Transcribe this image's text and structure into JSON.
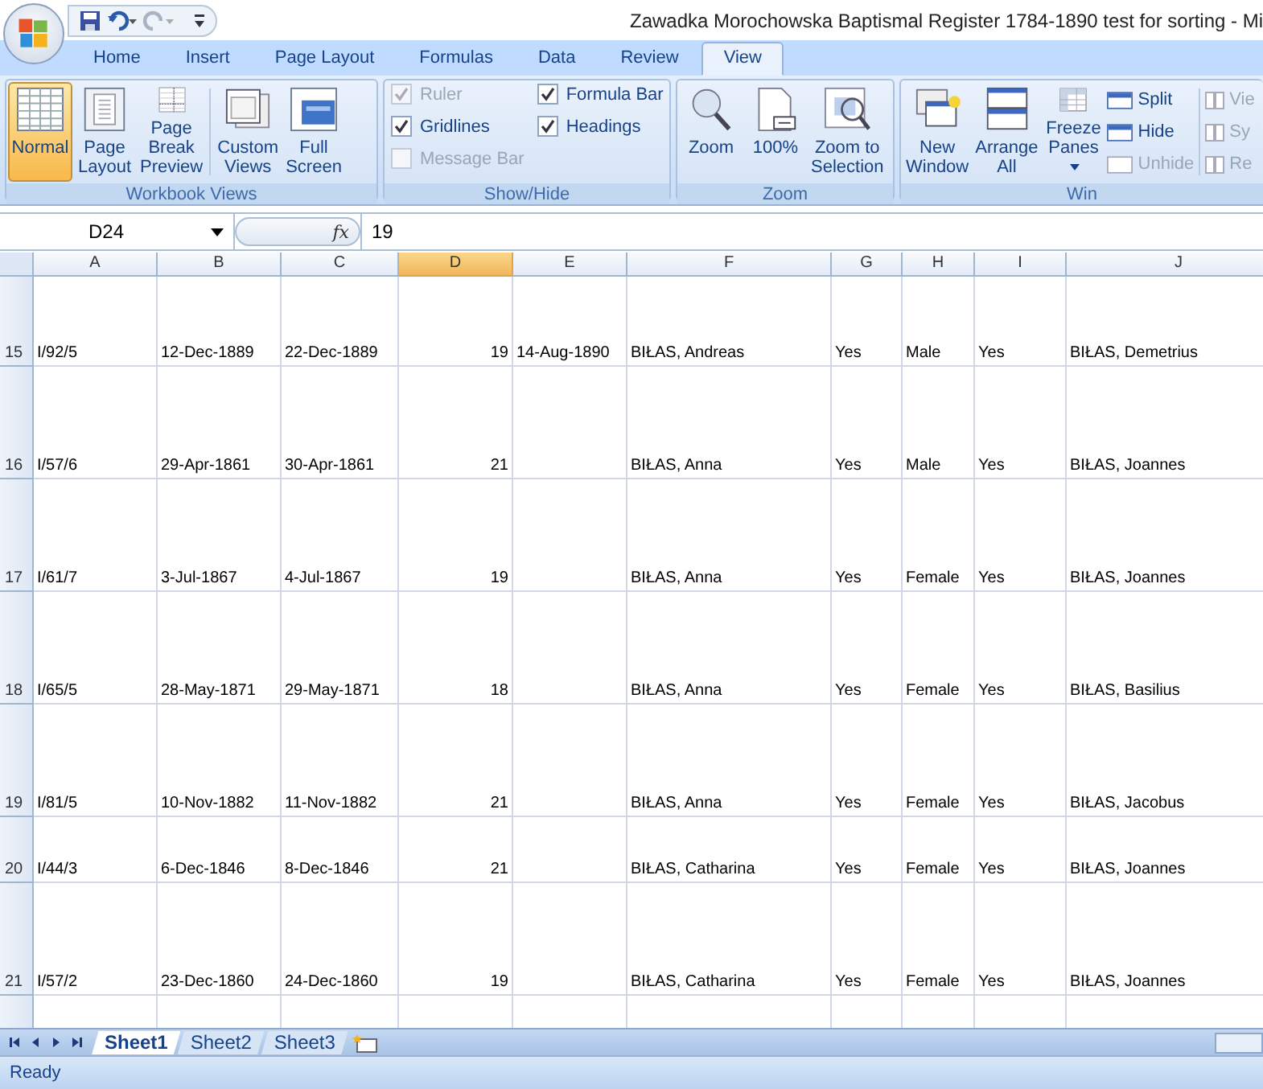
{
  "title": "Zawadka Morochowska Baptismal Register 1784-1890 test for sorting - Mi",
  "tabs": [
    {
      "label": "Home",
      "selected": false
    },
    {
      "label": "Insert",
      "selected": false
    },
    {
      "label": "Page Layout",
      "selected": false
    },
    {
      "label": "Formulas",
      "selected": false
    },
    {
      "label": "Data",
      "selected": false
    },
    {
      "label": "Review",
      "selected": false
    },
    {
      "label": "View",
      "selected": true
    }
  ],
  "workbook_views": {
    "title": "Workbook Views",
    "buttons": [
      {
        "label": "Normal",
        "selected": true
      },
      {
        "label": "Page Layout",
        "selected": false
      },
      {
        "label": "Page Break Preview",
        "selected": false
      },
      {
        "label": "Custom Views",
        "selected": false
      },
      {
        "label": "Full Screen",
        "selected": false
      }
    ]
  },
  "show_hide": {
    "title": "Show/Hide",
    "checkboxes": [
      {
        "label": "Ruler",
        "checked": true,
        "disabled": true
      },
      {
        "label": "Gridlines",
        "checked": true,
        "disabled": false
      },
      {
        "label": "Message Bar",
        "checked": false,
        "disabled": true
      },
      {
        "label": "Formula Bar",
        "checked": true,
        "disabled": false
      },
      {
        "label": "Headings",
        "checked": true,
        "disabled": false
      }
    ]
  },
  "zoom": {
    "title": "Zoom",
    "buttons": [
      {
        "label": "Zoom"
      },
      {
        "label": "100%"
      },
      {
        "label": "Zoom to Selection"
      }
    ]
  },
  "window": {
    "title": "Win",
    "buttons": [
      {
        "label": "New Window",
        "dropdown": false
      },
      {
        "label": "Arrange All",
        "dropdown": false
      },
      {
        "label": "Freeze Panes",
        "dropdown": true
      }
    ],
    "small_buttons": [
      {
        "label": "Split",
        "disabled": false
      },
      {
        "label": "Hide",
        "disabled": false
      },
      {
        "label": "Unhide",
        "disabled": true
      }
    ],
    "cut_buttons": [
      {
        "label": "Vie"
      },
      {
        "label": "Sy"
      },
      {
        "label": "Re"
      }
    ]
  },
  "name_box": "D24",
  "function_label": "fx",
  "formula": "19",
  "columns": [
    {
      "label": "A",
      "selected": false
    },
    {
      "label": "B",
      "selected": false
    },
    {
      "label": "C",
      "selected": false
    },
    {
      "label": "D",
      "selected": true
    },
    {
      "label": "E",
      "selected": false
    },
    {
      "label": "F",
      "selected": false
    },
    {
      "label": "G",
      "selected": false
    },
    {
      "label": "H",
      "selected": false
    },
    {
      "label": "I",
      "selected": false
    },
    {
      "label": "J",
      "selected": false
    }
  ],
  "rows": [
    {
      "number": "15",
      "cells": {
        "A": "I/92/5",
        "B": "12-Dec-1889",
        "C": "22-Dec-1889",
        "D": "19",
        "E": "14-Aug-1890",
        "F": "BIŁAS, Andreas",
        "G": "Yes",
        "H": "Male",
        "I": "Yes",
        "J": "BIŁAS, Demetrius"
      }
    },
    {
      "number": "16",
      "cells": {
        "A": "I/57/6",
        "B": "29-Apr-1861",
        "C": "30-Apr-1861",
        "D": "21",
        "F": "BIŁAS, Anna",
        "G": "Yes",
        "H": "Male",
        "I": "Yes",
        "J": "BIŁAS, Joannes"
      }
    },
    {
      "number": "17",
      "cells": {
        "A": "I/61/7",
        "B": "3-Jul-1867",
        "C": "4-Jul-1867",
        "D": "19",
        "F": "BIŁAS, Anna",
        "G": "Yes",
        "H": "Female",
        "I": "Yes",
        "J": "BIŁAS, Joannes"
      }
    },
    {
      "number": "18",
      "cells": {
        "A": "I/65/5",
        "B": "28-May-1871",
        "C": "29-May-1871",
        "D": "18",
        "F": "BIŁAS, Anna",
        "G": "Yes",
        "H": "Female",
        "I": "Yes",
        "J": "BIŁAS, Basilius"
      }
    },
    {
      "number": "19",
      "cells": {
        "A": "I/81/5",
        "B": "10-Nov-1882",
        "C": "11-Nov-1882",
        "D": "21",
        "F": "BIŁAS, Anna",
        "G": "Yes",
        "H": "Female",
        "I": "Yes",
        "J": "BIŁAS, Jacobus"
      }
    },
    {
      "number": "20",
      "cells": {
        "A": "I/44/3",
        "B": "6-Dec-1846",
        "C": "8-Dec-1846",
        "D": "21",
        "F": "BIŁAS, Catharina",
        "G": "Yes",
        "H": "Female",
        "I": "Yes",
        "J": "BIŁAS, Joannes"
      }
    },
    {
      "number": "21",
      "cells": {
        "A": "I/57/2",
        "B": "23-Dec-1860",
        "C": "24-Dec-1860",
        "D": "19",
        "F": "BIŁAS, Catharina",
        "G": "Yes",
        "H": "Female",
        "I": "Yes",
        "J": "BIŁAS, Joannes"
      }
    }
  ],
  "sheets": [
    {
      "label": "Sheet1",
      "selected": true
    },
    {
      "label": "Sheet2",
      "selected": false
    },
    {
      "label": "Sheet3",
      "selected": false
    }
  ],
  "status": "Ready"
}
